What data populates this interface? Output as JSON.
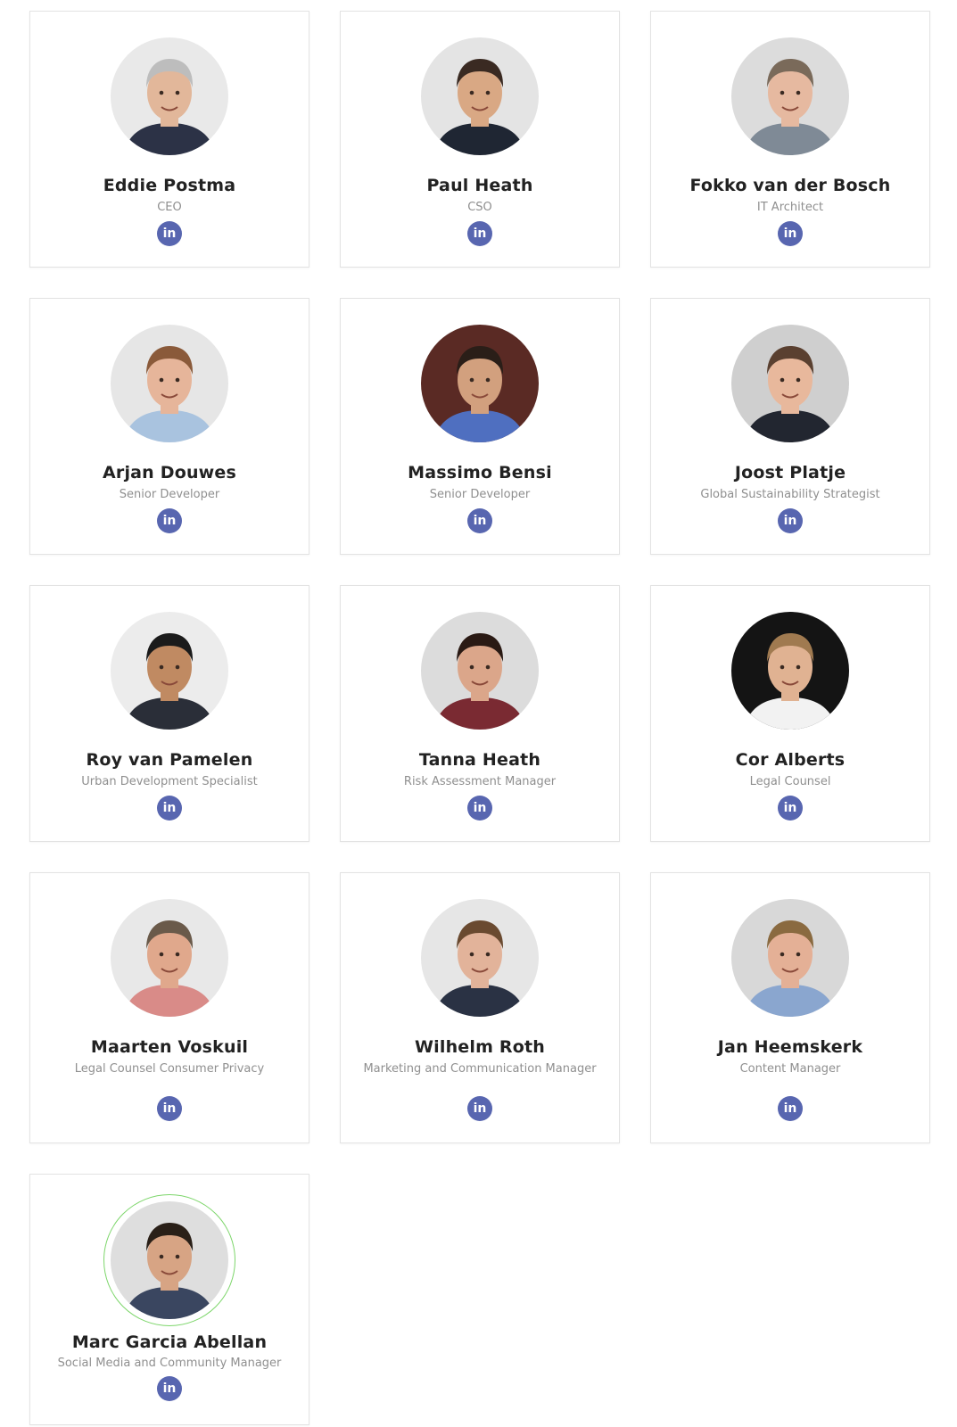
{
  "team": [
    {
      "name": "Eddie Postma",
      "role": "CEO",
      "linkedin": "in",
      "skin": "#e2b79a",
      "hair": "#bdbdbd",
      "shirt": "#2c3246",
      "bg": "#e9e9e9"
    },
    {
      "name": "Paul Heath",
      "role": "CSO",
      "linkedin": "in",
      "skin": "#d9a884",
      "hair": "#3a2a22",
      "shirt": "#1f2633",
      "bg": "#e4e4e4"
    },
    {
      "name": "Fokko van der Bosch",
      "role": "IT Architect",
      "linkedin": "in",
      "skin": "#e6b9a0",
      "hair": "#7a6a5a",
      "shirt": "#7f8a96",
      "bg": "#dcdcdc"
    },
    {
      "name": "Arjan Douwes",
      "role": "Senior Developer",
      "linkedin": "in",
      "skin": "#e6b59a",
      "hair": "#8a5a3a",
      "shirt": "#a9c3df",
      "bg": "#e6e6e6"
    },
    {
      "name": "Massimo Bensi",
      "role": "Senior Developer",
      "linkedin": "in",
      "skin": "#d2a07e",
      "hair": "#2a1e18",
      "shirt": "#4f6fc0",
      "bg": "#5a2a24"
    },
    {
      "name": "Joost Platje",
      "role": "Global Sustainability Strategist",
      "linkedin": "in",
      "skin": "#e8b89c",
      "hair": "#5a4030",
      "shirt": "#222630",
      "bg": "#cfcfcf"
    },
    {
      "name": "Roy van Pamelen",
      "role": "Urban Development Specialist",
      "linkedin": "in",
      "skin": "#c08a62",
      "hair": "#1b1b1b",
      "shirt": "#2a2e38",
      "bg": "#ececec"
    },
    {
      "name": "Tanna Heath",
      "role": "Risk Assessment Manager",
      "linkedin": "in",
      "skin": "#dba68a",
      "hair": "#2a1a14",
      "shirt": "#7a2a32",
      "bg": "#dcdcdc"
    },
    {
      "name": "Cor Alberts",
      "role": "Legal Counsel",
      "linkedin": "in",
      "skin": "#e0b292",
      "hair": "#a07a50",
      "shirt": "#f2f2f2",
      "bg": "#141414"
    },
    {
      "name": "Maarten Voskuil",
      "role": "Legal Counsel Consumer Privacy",
      "linkedin": "in",
      "skin": "#e0a88c",
      "hair": "#6a5a4a",
      "shirt": "#d98b88",
      "bg": "#e8e8e8"
    },
    {
      "name": "Wilhelm Roth",
      "role": "Marketing and Communication Manager",
      "linkedin": "in",
      "skin": "#e2b39a",
      "hair": "#6a4a30",
      "shirt": "#2a3244",
      "bg": "#e6e6e6"
    },
    {
      "name": "Jan Heemskerk",
      "role": "Content Manager",
      "linkedin": "in",
      "skin": "#e4b096",
      "hair": "#8a6a40",
      "shirt": "#8aa6cf",
      "bg": "#d8d8d8"
    },
    {
      "name": "Marc Garcia Abellan",
      "role": "Social Media and Community Manager",
      "linkedin": "in",
      "skin": "#d7a484",
      "hair": "#2a2018",
      "shirt": "#3a4660",
      "bg": "#dedede"
    }
  ]
}
